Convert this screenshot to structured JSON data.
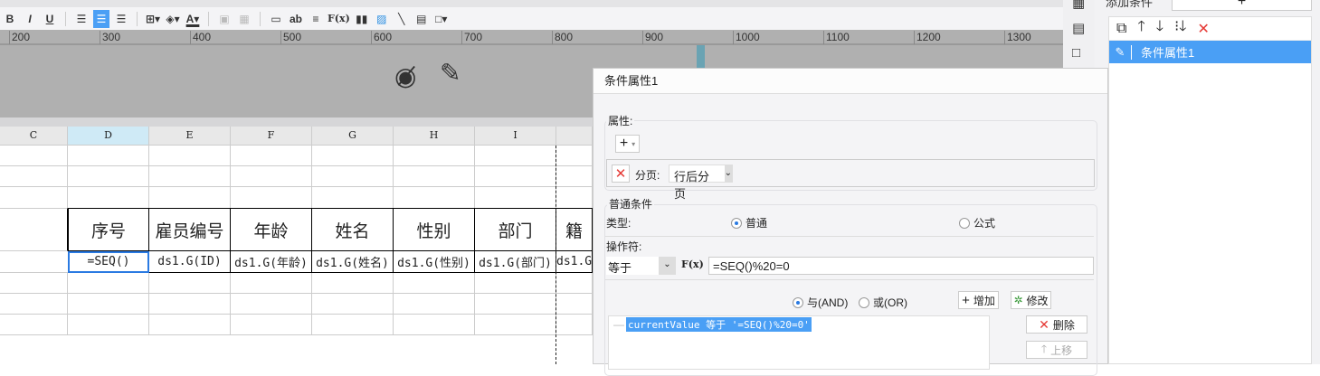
{
  "toolbar": {
    "bold": "B",
    "italic": "I",
    "underline": "U",
    "text_icon": "ab",
    "formula": "F(x)"
  },
  "ruler": {
    "labels": [
      "200",
      "300",
      "400",
      "500",
      "600",
      "700",
      "800",
      "900",
      "1000",
      "1100",
      "1200",
      "1300"
    ]
  },
  "columns": [
    "C",
    "D",
    "E",
    "F",
    "G",
    "H",
    "I",
    ""
  ],
  "header_row": [
    "",
    "序号",
    "雇员编号",
    "年龄",
    "姓名",
    "性别",
    "部门",
    "籍"
  ],
  "data_row": [
    "",
    "=SEQ()",
    "ds1.G(ID)",
    "ds1.G(年龄)",
    "ds1.G(姓名)",
    "ds1.G(性别)",
    "ds1.G(部门)",
    "ds1.G"
  ],
  "panel": {
    "add_condition": "添加条件",
    "add_plus": "+",
    "items": [
      "条件属性1"
    ]
  },
  "dialog": {
    "title": "条件属性1",
    "attr_legend": "属性:",
    "page_label": "分页:",
    "page_value": "行后分页",
    "normal_legend": "普通条件",
    "type_label": "类型:",
    "type_normal": "普通",
    "type_formula": "公式",
    "operator_label": "操作符:",
    "operator_value": "等于",
    "fx": "F(x)",
    "formula_value": "=SEQ()%20=0",
    "and_label": "与(AND)",
    "or_label": "或(OR)",
    "add_btn": "增加",
    "modify_btn": "修改",
    "delete_btn": "删除",
    "moveup_btn": "上移",
    "condition_item": "currentValue 等于 '=SEQ()%20=0'"
  }
}
